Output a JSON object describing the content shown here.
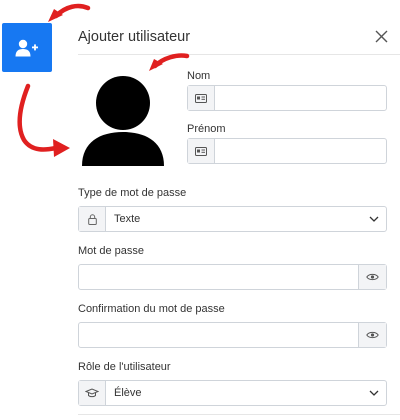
{
  "dialog": {
    "title": "Ajouter utilisateur",
    "close_icon": "close-icon"
  },
  "launcher": {
    "icon": "add-user-icon",
    "color": "#1778f2"
  },
  "avatar": {
    "icon": "user-silhouette-icon"
  },
  "form": {
    "nom": {
      "label": "Nom",
      "value": "",
      "icon": "id-card-icon"
    },
    "prenom": {
      "label": "Prénom",
      "value": "",
      "icon": "id-card-icon"
    },
    "password_type": {
      "label": "Type de mot de passe",
      "selected": "Texte",
      "icon": "lock-icon"
    },
    "password": {
      "label": "Mot de passe",
      "value": "",
      "icon": "eye-icon"
    },
    "password_confirm": {
      "label": "Confirmation du mot de passe",
      "value": "",
      "icon": "eye-icon"
    },
    "role": {
      "label": "Rôle de l'utilisateur",
      "selected": "Élève",
      "icon": "graduation-cap-icon"
    }
  },
  "annotation_color": "#e02020"
}
